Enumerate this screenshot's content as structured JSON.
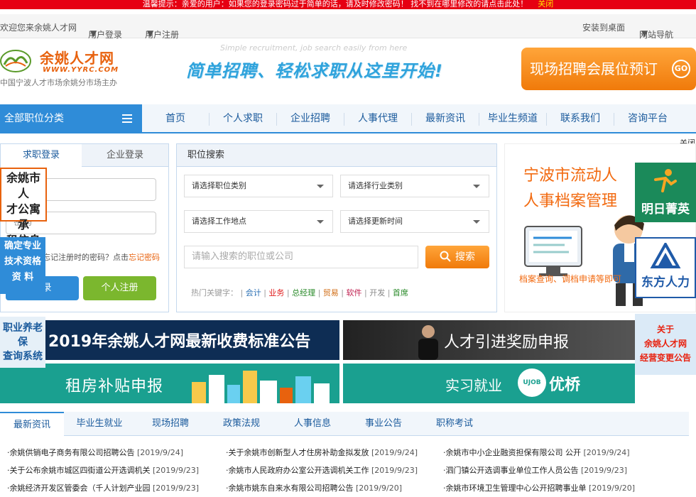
{
  "notice": {
    "text": "温馨提示：亲爱的用户：如果您的登录密码过于简单的话，请及时修改密码！ 找不到在哪里修改的请点击此处！",
    "close": "关闭"
  },
  "topbar": {
    "welcome": "欢迎您来余姚人才网",
    "user_login": "用户登录",
    "user_register": "用户注册",
    "install_desktop": "安装到桌面",
    "site_nav": "网站导航"
  },
  "header": {
    "logo_title": "余姚人才网",
    "logo_url": "WWW.YYRC.COM",
    "logo_tagline": "中国宁波人才市场余姚分市场主办",
    "slogan": "简单招聘、轻松求职从这里开始!",
    "slogan_sub": "Simple recruitment, job search easily from here",
    "booking": "现场招聘会展位预订",
    "booking_go": "GO"
  },
  "nav": {
    "all_categories": "全部职位分类",
    "items": [
      "首页",
      "个人求职",
      "企业招聘",
      "人事代理",
      "最新资讯",
      "毕业生频道",
      "联系我们",
      "咨询平台"
    ]
  },
  "close_link": "关闭",
  "login": {
    "tabs": [
      "求职登录",
      "企业登录"
    ],
    "password_placeholder": "密码",
    "forgot_text": "忘记注册时的密码？点击",
    "forgot_link": "忘记密码",
    "login_button": "登录",
    "register_button": "个人注册"
  },
  "search": {
    "title": "职位搜索",
    "job_category": "请选择职位类别",
    "industry": "请选择行业类别",
    "location": "请选择工作地点",
    "update_time": "请选择更新时间",
    "keyword_placeholder": "请输入搜索的职位或公司",
    "search_button": "搜索",
    "hot_label": "热门关键字：",
    "hot_keywords": [
      "会计",
      "业务",
      "总经理",
      "贸易",
      "软件",
      "开发",
      "首席"
    ]
  },
  "archive_ad": {
    "line1": "宁波市流动人",
    "line2": "人事档案管理",
    "line3": "档案查询、调档申请等即可"
  },
  "right_ads": {
    "mingri": "明日菁英",
    "dongfang": "东方人力",
    "notice_line1": "关于",
    "notice_line2": "余姚人才网",
    "notice_line3": "经营变更公告"
  },
  "left_floats": {
    "apartment": [
      "余姚市人",
      "才公寓承",
      "租信息"
    ],
    "qualification": [
      "确定专业",
      "技术资格",
      "资 料"
    ],
    "pension": [
      "职业养老保",
      "查询系统"
    ]
  },
  "banners": {
    "fee": "2019年余姚人才网最新收费标准公告",
    "reward": "人才引进奖励申报",
    "rent": "租房补贴申报",
    "intern": "实习就业",
    "ujob": "UJOB",
    "youqiao": "优桥"
  },
  "news_tabs": [
    "最新资讯",
    "毕业生就业",
    "现场招聘",
    "政策法规",
    "人事信息",
    "事业公告",
    "职称考试"
  ],
  "news": [
    {
      "title": "余姚供销电子商务有限公司招聘公告",
      "date": "[2019/9/24]"
    },
    {
      "title": "关于余姚市创新型人才住房补助金拟发放",
      "date": "[2019/9/24]"
    },
    {
      "title": "余姚市中小企业融资担保有限公司 公开",
      "date": "[2019/9/24]"
    },
    {
      "title": "关于公布余姚市城区四街道公开选调机关",
      "date": "[2019/9/23]"
    },
    {
      "title": "余姚市人民政府办公室公开选调机关工作",
      "date": "[2019/9/23]"
    },
    {
      "title": "泗门镇公开选调事业单位工作人员公告",
      "date": "[2019/9/23]"
    },
    {
      "title": "余姚经济开发区管委会（千人计划产业园",
      "date": "[2019/9/23]"
    },
    {
      "title": "余姚市姚东自来水有限公司招聘公告",
      "date": "[2019/9/20]"
    },
    {
      "title": "余姚市环境卫生管理中心公开招聘事业单",
      "date": "[2019/9/20]"
    }
  ],
  "colors": {
    "notice_bg": "#e60012",
    "nav_blue": "#2f8cd8",
    "orange": "#f07a0a",
    "green": "#7bb72e",
    "teal": "#1aa090",
    "navy": "#0e2d54"
  }
}
